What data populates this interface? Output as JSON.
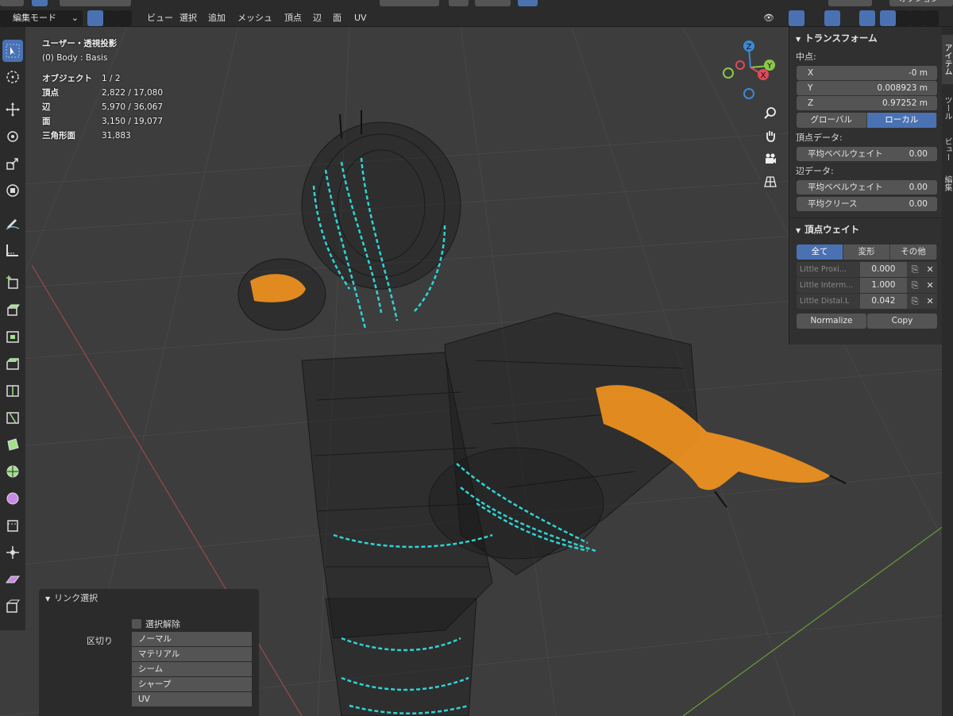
{
  "header": {
    "mode_label": "編集モード",
    "menus": [
      "ビュー",
      "選択",
      "追加",
      "メッシュ",
      "頂点",
      "辺",
      "面",
      "UV"
    ],
    "options_label": "オプション"
  },
  "stats": {
    "view_name": "ユーザー・透視投影",
    "object_name": "(0) Body : Basis",
    "rows": [
      {
        "label": "オブジェクト",
        "value": "1 / 2"
      },
      {
        "label": "頂点",
        "value": "2,822 / 17,080"
      },
      {
        "label": "辺",
        "value": "5,970 / 36,067"
      },
      {
        "label": "面",
        "value": "3,150 / 19,077"
      },
      {
        "label": "三角形面",
        "value": "31,883"
      }
    ]
  },
  "gizmo": {
    "z": "Z",
    "y": "Y",
    "x": "X"
  },
  "transform": {
    "title": "トランスフォーム",
    "median_label": "中点:",
    "x_label": "X",
    "x_value": "-0 m",
    "y_label": "Y",
    "y_value": "0.008923 m",
    "z_label": "Z",
    "z_value": "0.97252 m",
    "global_label": "グローバル",
    "local_label": "ローカル",
    "vertex_data_label": "頂点データ:",
    "vertex_bevel_label": "平均ベベルウェイト",
    "vertex_bevel_value": "0.00",
    "edge_data_label": "辺データ:",
    "edge_bevel_label": "平均ベベルウェイト",
    "edge_bevel_value": "0.00",
    "crease_label": "平均クリース",
    "crease_value": "0.00"
  },
  "vertex_weights": {
    "title": "頂点ウェイト",
    "tabs": [
      "全て",
      "変形",
      "その他"
    ],
    "rows": [
      {
        "name": "Little Proxi...",
        "value": "0.000"
      },
      {
        "name": "Little Interm...",
        "value": "1.000"
      },
      {
        "name": "Little Distal.L",
        "value": "0.042"
      }
    ],
    "normalize_label": "Normalize",
    "copy_label": "Copy"
  },
  "side_tabs": [
    "アイテム",
    "ツール",
    "ビュー",
    "編集"
  ],
  "operator_panel": {
    "title": "リンク選択",
    "deselect_label": "選択解除",
    "delimit_label": "区切り",
    "delimit_options": [
      "ノーマル",
      "マテリアル",
      "シーム",
      "シャープ",
      "UV"
    ]
  },
  "colors": {
    "accent": "#4a72b3",
    "selected_mesh": "#f0921e",
    "seam": "#2fd4d4",
    "background": "#3d3d3d"
  }
}
